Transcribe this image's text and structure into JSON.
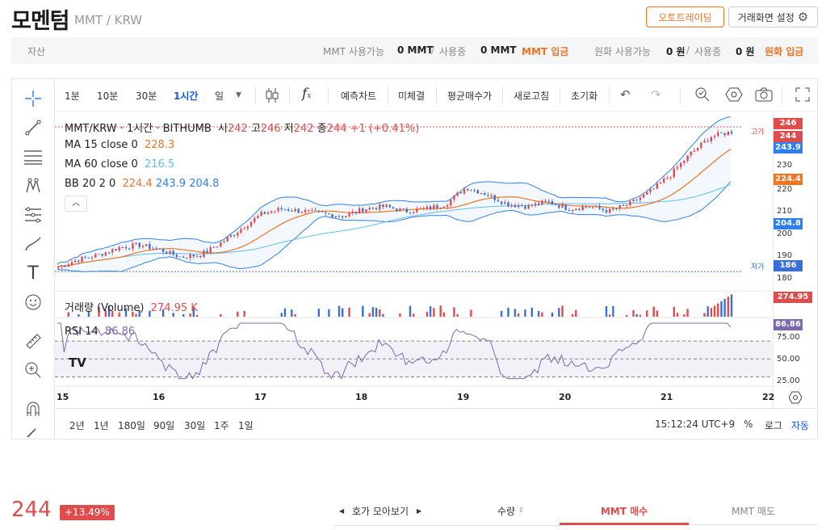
{
  "header": {
    "coin_name": "모멘텀",
    "pair": "MMT / KRW",
    "auto_trade_label": "오토트레이딩",
    "settings_label": "거래화면 설정"
  },
  "assets": {
    "label": "자산",
    "mmt_available_label": "MMT 사용가능",
    "mmt_available_value": "0 MMT",
    "sep": "/",
    "mmt_in_use_label": "사용중",
    "mmt_in_use_value": "0 MMT",
    "mmt_deposit_label": "MMT 입금",
    "krw_available_label": "원화 사용가능",
    "krw_available_value": "0 원",
    "krw_in_use_label": "사용중",
    "krw_in_use_value": "0 원",
    "krw_deposit_label": "원화 입금"
  },
  "toolbar": {
    "intervals": [
      "1분",
      "10분",
      "30분",
      "1시간",
      "일"
    ],
    "active_interval": "1시간",
    "forecast_label": "예측차트",
    "unfilled_label": "미체결",
    "avg_price_label": "평균매수가",
    "refresh_label": "새로고침",
    "reset_label": "초기화",
    "fx_label": "f"
  },
  "legend": {
    "symbol": "MMT/KRW · 1시간 · BITHUMB",
    "open_label": "시",
    "open": "242",
    "high_label": "고",
    "high": "246",
    "low_label": "저",
    "low": "242",
    "close_label": "종",
    "close": "244",
    "change": "+1 (+0.41%)",
    "ma15_label": "MA 15 close 0",
    "ma15": "228.3",
    "ma60_label": "MA 60 close 0",
    "ma60": "216.5",
    "bb_label": "BB 20 2 0",
    "bb_mid": "224.4",
    "bb_up": "243.9",
    "bb_low": "204.8",
    "volume_label": "거래량 (Volume)",
    "volume": "274.95 K",
    "rsi_label": "RSI 14",
    "rsi": "86.86"
  },
  "price_tags": {
    "high_tag": "246",
    "last_tag": "244",
    "bb_up_tag": "243.9",
    "ma_tag": "224.4",
    "bb_low_tag": "204.8",
    "low_tag": "186",
    "vol_tag": "274.95 K",
    "rsi_tag": "86.86",
    "high_marker_label": "고가",
    "low_marker_label": "저가"
  },
  "axis": {
    "price_ticks": [
      "230",
      "220",
      "210",
      "200",
      "190",
      "180"
    ],
    "rsi_ticks": [
      "75.00",
      "50.00",
      "25.00"
    ],
    "dates": [
      "15",
      "16",
      "17",
      "18",
      "19",
      "20",
      "21",
      "22"
    ]
  },
  "bottom_bar": {
    "ranges": [
      "2년",
      "1년",
      "180일",
      "90일",
      "30일",
      "1주",
      "1일"
    ],
    "time": "15:12:24 UTC+9",
    "percent_label": "%",
    "log_label": "로그",
    "auto_label": "자동"
  },
  "trade": {
    "last_price": "244",
    "change_pct": "+13.49%",
    "orderbook_label": "호가 모아보기",
    "quantity_label": "수량",
    "buy_tab": "MMT 매수",
    "sell_tab": "MMT 매도"
  },
  "colors": {
    "up": "#e04c4c",
    "down": "#3a6fd8",
    "accent": "#f37321",
    "ma60": "#5bc0eb",
    "bb": "#2f80ed",
    "rsi": "#7b68b0"
  },
  "chart_data": {
    "type": "candlestick",
    "timeframe": "1시간",
    "x_dates": [
      "15",
      "16",
      "17",
      "18",
      "19",
      "20",
      "21",
      "22"
    ],
    "ylim": [
      180,
      248
    ],
    "approx_close_path": [
      188,
      191,
      193,
      196,
      197,
      195,
      192,
      193,
      198,
      204,
      210,
      212,
      211,
      210,
      209,
      212,
      213,
      211,
      212,
      214,
      221,
      218,
      214,
      213,
      215,
      212,
      213,
      211,
      214,
      219,
      226,
      235,
      242,
      244
    ],
    "rsi_range": [
      25,
      90
    ],
    "volume_last": "274.95 K"
  }
}
